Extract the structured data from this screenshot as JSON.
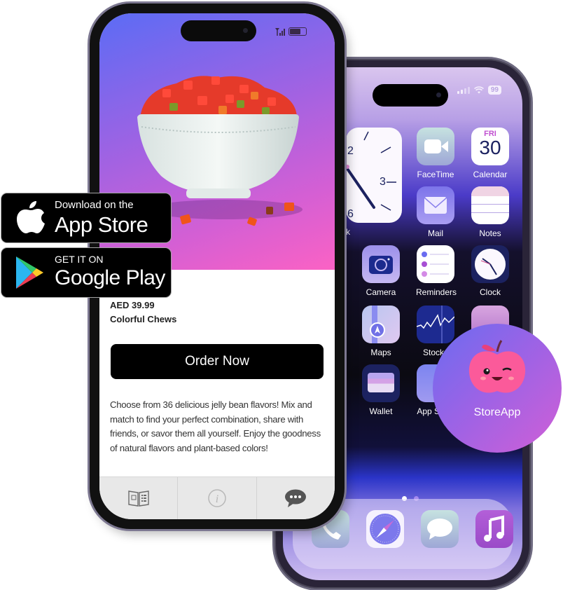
{
  "badges": {
    "app_store": {
      "small": "Download on the",
      "large": "App Store",
      "icon": "apple-icon"
    },
    "google_play": {
      "small": "GET IT ON",
      "large": "Google Play",
      "icon": "google-play-icon"
    }
  },
  "front_phone": {
    "status": {
      "signal_icon": "signal-icon",
      "battery_icon": "battery-icon"
    },
    "product": {
      "image": "jelly-candy-bowl-image",
      "price": "AED 39.99",
      "name": "Colorful Chews",
      "order_button": "Order Now",
      "description": "Choose from 36 delicious jelly bean flavors! Mix and match to find your perfect combination, share with friends, or savor them all yourself. Enjoy the goodness of natural flavors and plant-based colors!"
    },
    "tabs": [
      {
        "name": "catalog",
        "icon": "catalog-book-icon"
      },
      {
        "name": "info",
        "icon": "info-icon"
      },
      {
        "name": "chat",
        "icon": "chat-bubble-icon"
      }
    ]
  },
  "back_phone": {
    "status": {
      "battery": "99"
    },
    "widget_label": "Clock",
    "apps": [
      {
        "label": "FaceTime"
      },
      {
        "label": "Calendar",
        "day": "FRI",
        "date": "30"
      },
      {
        "label": "Mail"
      },
      {
        "label": "Notes"
      },
      {
        "label": "Camera"
      },
      {
        "label": "Reminders"
      },
      {
        "label": "Clock"
      },
      {
        "label": "Maps"
      },
      {
        "label": "Stocks"
      },
      {
        "label": "Wallet"
      },
      {
        "label": "App Store"
      }
    ],
    "dock": [
      "Phone",
      "Safari",
      "Messages",
      "Music"
    ],
    "page_count": 2,
    "current_page": 1
  },
  "store_app": {
    "label": "StoreApp"
  },
  "colors": {
    "hero_start": "#5b6cf5",
    "hero_end": "#fb62c4",
    "button": "#000000",
    "store_circle_start": "#6a6cf0",
    "store_circle_end": "#d15fd6"
  }
}
